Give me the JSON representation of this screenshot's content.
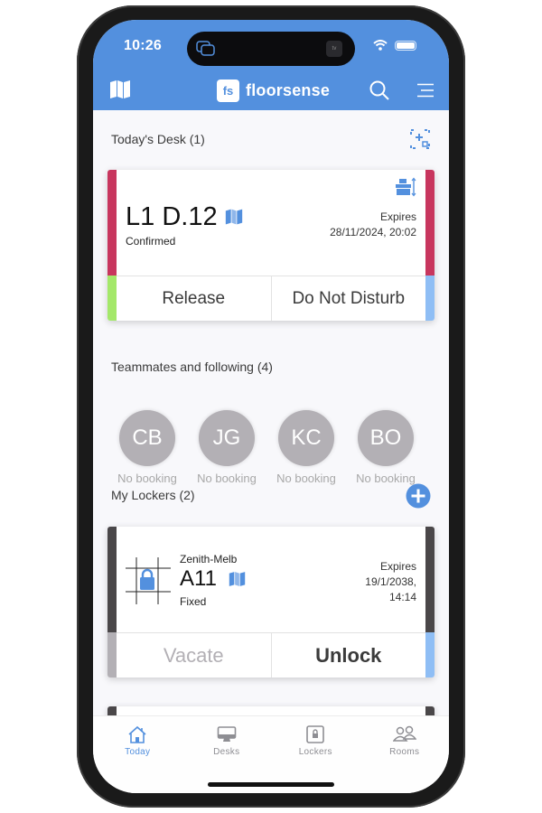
{
  "status_bar": {
    "time": "10:26",
    "island_app": "tv"
  },
  "header": {
    "brand_logo": "fs",
    "brand_name": "floorsense",
    "left_icon": "map-icon",
    "right_icons": [
      "search-icon",
      "menu-icon"
    ]
  },
  "todays_desk": {
    "heading": "Today's Desk (1)",
    "header_icon": "scan-add-icon",
    "card": {
      "title": "L1 D.12",
      "status": "Confirmed",
      "expires_label": "Expires",
      "expires_value": "28/11/2024, 20:02",
      "actions": [
        "Release",
        "Do Not Disturb"
      ],
      "colors": {
        "side": "#c8365e",
        "release_accent": "#a4e86a",
        "dnd_accent": "#8fbef5"
      }
    }
  },
  "teammates": {
    "heading": "Teammates and following (4)",
    "people": [
      {
        "initials": "CB",
        "status": "No booking"
      },
      {
        "initials": "JG",
        "status": "No booking"
      },
      {
        "initials": "KC",
        "status": "No booking"
      },
      {
        "initials": "BO",
        "status": "No booking"
      }
    ]
  },
  "lockers": {
    "heading": "My Lockers (2)",
    "add_icon": "add-circle-icon",
    "card": {
      "location": "Zenith-Melb",
      "title": "A11",
      "status": "Fixed",
      "expires_label": "Expires",
      "expires_date": "19/1/2038,",
      "expires_time": "14:14",
      "actions": [
        "Vacate",
        "Unlock"
      ],
      "colors": {
        "side": "#4a4749",
        "vacate_accent": "#b3b0b5",
        "unlock_accent": "#8fbef5"
      }
    }
  },
  "tabbar": {
    "tabs": [
      {
        "label": "Today",
        "icon": "home-icon",
        "active": true
      },
      {
        "label": "Desks",
        "icon": "monitor-icon",
        "active": false
      },
      {
        "label": "Lockers",
        "icon": "locker-icon",
        "active": false
      },
      {
        "label": "Rooms",
        "icon": "people-icon",
        "active": false
      }
    ]
  },
  "colors": {
    "brand": "#5390de",
    "background": "#f8f8fb"
  }
}
